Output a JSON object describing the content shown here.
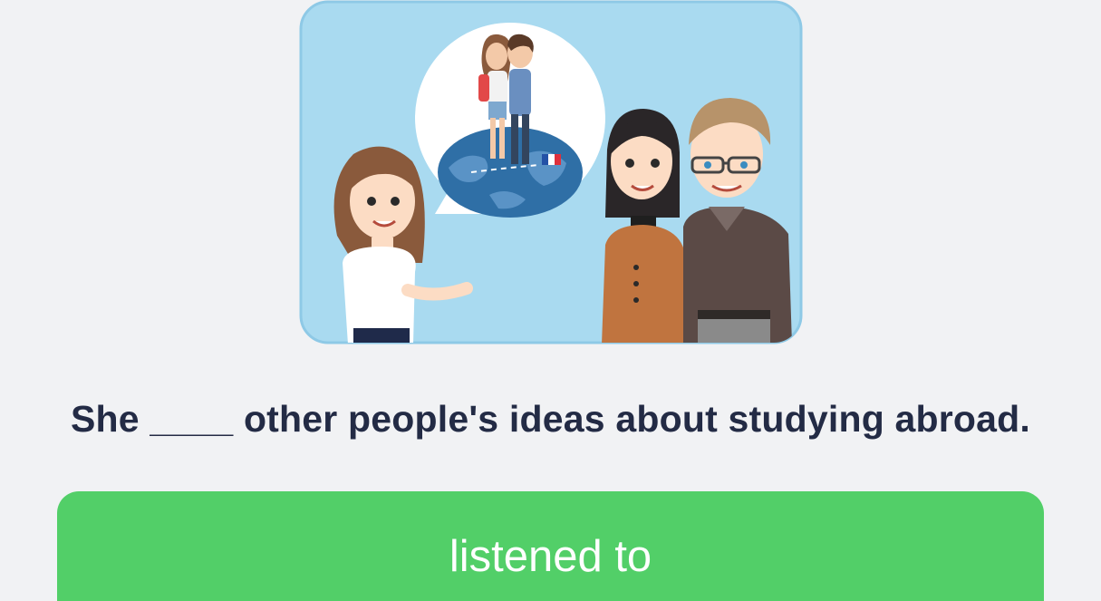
{
  "exercise": {
    "illustration_icon": "scene-girl-talking-to-parents-about-study-abroad",
    "prompt": "She ____ other people's ideas about studying abroad.",
    "options": [
      {
        "label": "listened to"
      }
    ]
  },
  "colors": {
    "background": "#f1f2f4",
    "prompt_text": "#232b45",
    "option_button": "#52cf68",
    "option_text": "#ffffff",
    "illustration_bg": "#a9daf0"
  }
}
